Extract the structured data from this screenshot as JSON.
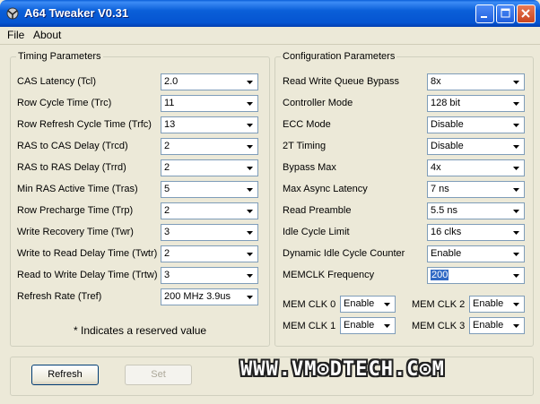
{
  "window": {
    "title": "A64 Tweaker V0.31"
  },
  "menu": {
    "file": "File",
    "about": "About"
  },
  "timing": {
    "title": "Timing Parameters",
    "rows": [
      {
        "label": "CAS Latency (Tcl)",
        "value": "2.0"
      },
      {
        "label": "Row Cycle Time (Trc)",
        "value": "11"
      },
      {
        "label": "Row Refresh Cycle Time (Trfc)",
        "value": "13"
      },
      {
        "label": "RAS to CAS Delay (Trcd)",
        "value": "2"
      },
      {
        "label": "RAS to RAS Delay (Trrd)",
        "value": "2"
      },
      {
        "label": "Min RAS Active Time (Tras)",
        "value": "5"
      },
      {
        "label": "Row Precharge Time (Trp)",
        "value": "2"
      },
      {
        "label": "Write Recovery Time (Twr)",
        "value": "3"
      },
      {
        "label": "Write to Read Delay Time (Twtr)",
        "value": "2"
      },
      {
        "label": "Read to Write Delay Time (Trtw)",
        "value": "3"
      },
      {
        "label": "Refresh Rate (Tref)",
        "value": "200 MHz 3.9us"
      }
    ],
    "note": "* Indicates a reserved value"
  },
  "config": {
    "title": "Configuration Parameters",
    "rows": [
      {
        "label": "Read Write Queue Bypass",
        "value": "8x"
      },
      {
        "label": "Controller Mode",
        "value": "128 bit"
      },
      {
        "label": "ECC Mode",
        "value": "Disable"
      },
      {
        "label": "2T Timing",
        "value": "Disable"
      },
      {
        "label": "Bypass Max",
        "value": "4x"
      },
      {
        "label": "Max Async Latency",
        "value": "7 ns"
      },
      {
        "label": "Read Preamble",
        "value": "5.5 ns"
      },
      {
        "label": "Idle Cycle Limit",
        "value": "16 clks"
      },
      {
        "label": "Dynamic Idle Cycle Counter",
        "value": "Enable"
      },
      {
        "label": "MEMCLK Frequency",
        "value": "200"
      }
    ],
    "memclk": [
      {
        "label": "MEM CLK 0",
        "value": "Enable"
      },
      {
        "label": "MEM CLK 2",
        "value": "Enable"
      },
      {
        "label": "MEM CLK 1",
        "value": "Enable"
      },
      {
        "label": "MEM CLK 3",
        "value": "Enable"
      }
    ]
  },
  "buttons": {
    "refresh": "Refresh",
    "set": "Set"
  },
  "watermark": "WWW.VM⊙DTECH.C⊙M",
  "icons": {
    "app": "app-icon",
    "minimize": "minimize-icon",
    "maximize": "maximize-icon",
    "close": "close-icon",
    "dropdown": "chevron-down-icon"
  },
  "colors": {
    "titlebar": "#0a5fd8",
    "face": "#ece9d8",
    "selection": "#316ac5"
  }
}
